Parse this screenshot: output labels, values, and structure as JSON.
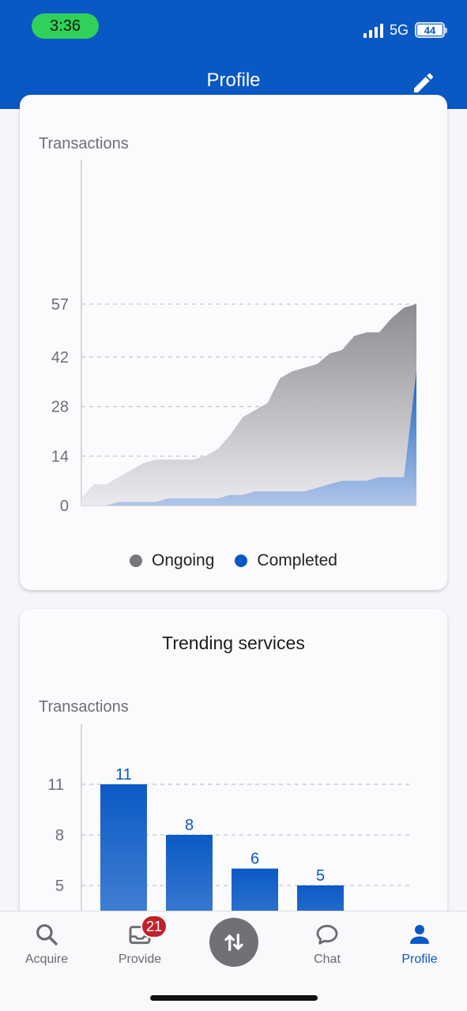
{
  "status_bar": {
    "time": "3:36",
    "network": "5G",
    "battery": "44"
  },
  "header": {
    "title": "Profile",
    "edit_icon": "pencil-icon"
  },
  "transactions_chart": {
    "y_title": "Transactions",
    "legend": [
      {
        "label": "Ongoing",
        "color": "#76767b"
      },
      {
        "label": "Completed",
        "color": "#0a58c4"
      }
    ]
  },
  "trending": {
    "title": "Trending services",
    "y_title": "Transactions"
  },
  "chart_data": [
    {
      "type": "area",
      "title": "",
      "ylabel": "Transactions",
      "y_ticks": [
        0,
        14,
        28,
        42,
        57
      ],
      "ylim": [
        0,
        57
      ],
      "grid": "horizontal dashed",
      "legend_position": "bottom",
      "series": [
        {
          "name": "Ongoing",
          "color": "#8c8c91",
          "values": [
            2,
            6,
            6,
            8,
            10,
            12,
            13,
            13,
            13,
            13,
            14,
            16,
            20,
            25,
            27,
            29,
            36,
            38,
            39,
            40,
            43,
            44,
            48,
            49,
            49,
            53,
            56,
            57
          ]
        },
        {
          "name": "Completed",
          "color": "#0a58c4",
          "values": [
            0,
            0,
            0,
            1,
            1,
            1,
            1,
            2,
            2,
            2,
            2,
            2,
            3,
            3,
            4,
            4,
            4,
            4,
            4,
            5,
            6,
            7,
            7,
            7,
            8,
            8,
            8,
            38
          ]
        }
      ]
    },
    {
      "type": "bar",
      "title": "Trending services",
      "ylabel": "Transactions",
      "y_ticks": [
        5,
        8,
        11
      ],
      "grid": "horizontal dashed",
      "values": [
        11,
        8,
        6,
        5
      ]
    }
  ],
  "tabs": [
    {
      "label": "Acquire",
      "icon": "search-icon"
    },
    {
      "label": "Provide",
      "icon": "inbox-icon",
      "badge": "21"
    },
    {
      "label": "",
      "icon": "exchange-icon"
    },
    {
      "label": "Chat",
      "icon": "chat-bubble-icon"
    },
    {
      "label": "Profile",
      "icon": "person-icon"
    }
  ]
}
